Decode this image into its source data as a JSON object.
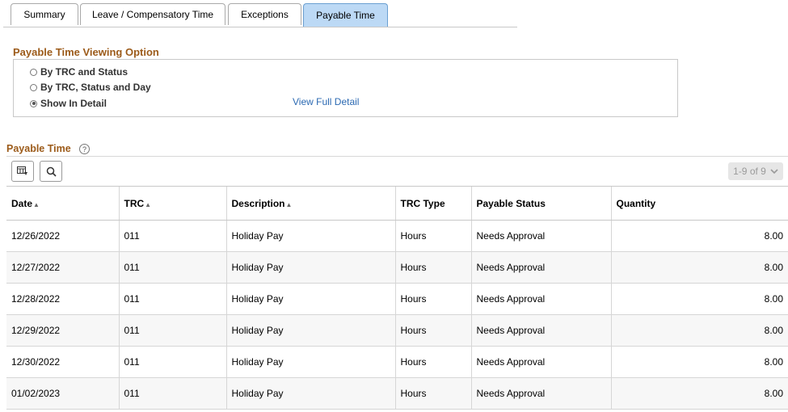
{
  "tabs": [
    {
      "label": "Summary",
      "active": false
    },
    {
      "label": "Leave / Compensatory Time",
      "active": false
    },
    {
      "label": "Exceptions",
      "active": false
    },
    {
      "label": "Payable Time",
      "active": true
    }
  ],
  "viewing_option": {
    "title": "Payable Time Viewing Option",
    "options": [
      {
        "label": "By TRC and Status",
        "selected": false
      },
      {
        "label": "By TRC, Status and Day",
        "selected": false
      },
      {
        "label": "Show In Detail",
        "selected": true
      }
    ],
    "link": "View Full Detail"
  },
  "grid": {
    "title": "Payable Time",
    "help_icon": "?",
    "pager": "1-9 of 9",
    "toolbar_icons": [
      "personalize-grid-icon",
      "find-icon"
    ],
    "columns": [
      "Date",
      "TRC",
      "Description",
      "TRC Type",
      "Payable Status",
      "Quantity"
    ],
    "rows": [
      {
        "date": "12/26/2022",
        "trc": "011",
        "description": "Holiday Pay",
        "trc_type": "Hours",
        "status": "Needs Approval",
        "quantity": "8.00"
      },
      {
        "date": "12/27/2022",
        "trc": "011",
        "description": "Holiday Pay",
        "trc_type": "Hours",
        "status": "Needs Approval",
        "quantity": "8.00"
      },
      {
        "date": "12/28/2022",
        "trc": "011",
        "description": "Holiday Pay",
        "trc_type": "Hours",
        "status": "Needs Approval",
        "quantity": "8.00"
      },
      {
        "date": "12/29/2022",
        "trc": "011",
        "description": "Holiday Pay",
        "trc_type": "Hours",
        "status": "Needs Approval",
        "quantity": "8.00"
      },
      {
        "date": "12/30/2022",
        "trc": "011",
        "description": "Holiday Pay",
        "trc_type": "Hours",
        "status": "Needs Approval",
        "quantity": "8.00"
      },
      {
        "date": "01/02/2023",
        "trc": "011",
        "description": "Holiday Pay",
        "trc_type": "Hours",
        "status": "Needs Approval",
        "quantity": "8.00"
      }
    ]
  }
}
